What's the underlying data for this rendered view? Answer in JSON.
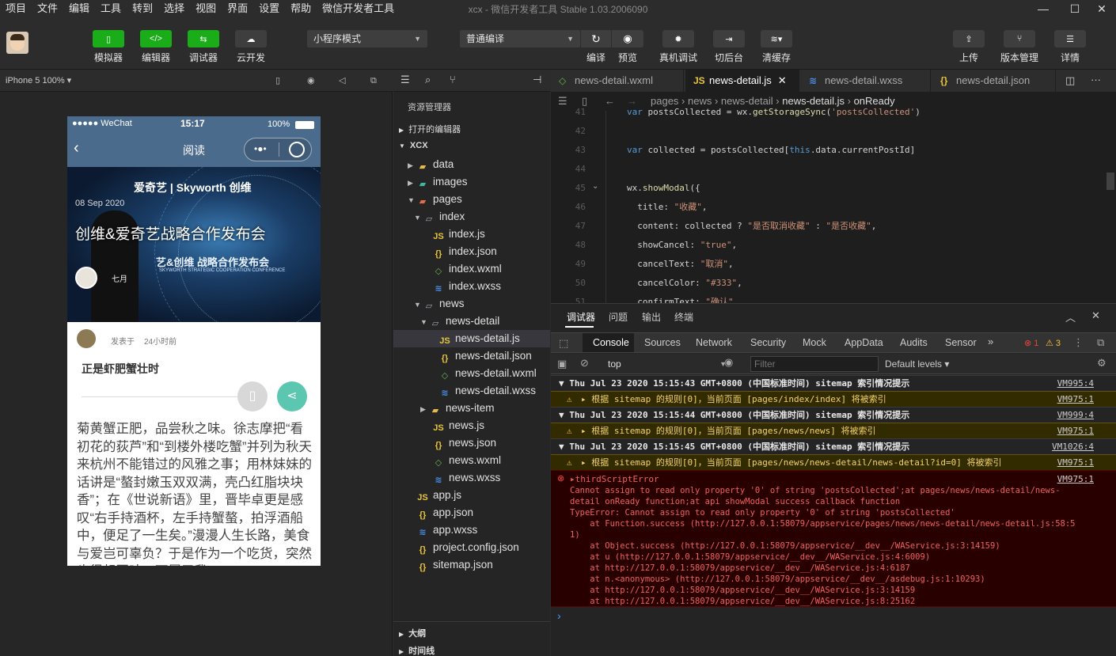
{
  "menubar": {
    "items": [
      "项目",
      "文件",
      "编辑",
      "工具",
      "转到",
      "选择",
      "视图",
      "界面",
      "设置",
      "帮助",
      "微信开发者工具"
    ],
    "title": "xcx - 微信开发者工具 Stable 1.03.2006090"
  },
  "toolbar": {
    "left_buttons": [
      {
        "label": "模拟器",
        "icon": "phone-icon"
      },
      {
        "label": "编辑器",
        "icon": "code-icon"
      },
      {
        "label": "调试器",
        "icon": "debug-icon"
      },
      {
        "label": "云开发",
        "icon": "cloud-icon"
      }
    ],
    "mode_select": "小程序模式",
    "compile_select": "普通编译",
    "compile_label": "编译",
    "preview_label": "预览",
    "real_debug_label": "真机调试",
    "background_label": "切后台",
    "clear_cache_label": "清缓存",
    "upload_label": "上传",
    "version_label": "版本管理",
    "details_label": "详情"
  },
  "simulator": {
    "device": "iPhone 5 100% ▾",
    "status_carrier": "●●●●● WeChat",
    "status_time": "15:17",
    "status_battery": "100%",
    "nav_title": "阅读",
    "hero_date": "08 Sep 2020",
    "hero_title": "创维&爱奇艺战略合作发布会",
    "hero_brand": "爱奇艺 | Skyworth 创维",
    "hero_sub": "艺&创维 战略合作发布会",
    "hero_sub_en": "SKYWORTH STRATEGIC COOPERATION CONFERENCE",
    "hero_author": "七月",
    "post_meta": "发表于",
    "post_time": "24小时前",
    "post_title": "正是虾肥蟹壮时",
    "article": "菊黄蟹正肥，品尝秋之味。徐志摩把“看初花的荻芦”和“到楼外楼吃蟹”并列为秋天来杭州不能错过的风雅之事；用林妹妹的话讲是“螯封嫩玉双双满，壳凸红脂块块香”；在《世说新语》里，晋毕卓更是感叹“右手持酒杯，左手持蟹螯，拍浮酒船中，便足了一生矣。”漫漫人生长路，美食与爱岂可辜负？于是作为一个吃货，突然也很想回味一下属于我"
  },
  "explorer": {
    "header": "资源管理器",
    "open_editors": "打开的编辑器",
    "project": "XCX",
    "tree": [
      {
        "label": "data",
        "depth": 1,
        "type": "folder",
        "arrow": "▸"
      },
      {
        "label": "images",
        "depth": 1,
        "type": "folder-img",
        "arrow": "▸"
      },
      {
        "label": "pages",
        "depth": 1,
        "type": "folder-pages",
        "arrow": "▾"
      },
      {
        "label": "index",
        "depth": 2,
        "type": "folder-open",
        "arrow": "▾"
      },
      {
        "label": "index.js",
        "depth": 3,
        "type": "js",
        "arrow": ""
      },
      {
        "label": "index.json",
        "depth": 3,
        "type": "json",
        "arrow": ""
      },
      {
        "label": "index.wxml",
        "depth": 3,
        "type": "wxml",
        "arrow": ""
      },
      {
        "label": "index.wxss",
        "depth": 3,
        "type": "wxss",
        "arrow": ""
      },
      {
        "label": "news",
        "depth": 2,
        "type": "folder-open",
        "arrow": "▾"
      },
      {
        "label": "news-detail",
        "depth": 3,
        "type": "folder-open",
        "arrow": "▾"
      },
      {
        "label": "news-detail.js",
        "depth": 4,
        "type": "js",
        "arrow": "",
        "selected": true
      },
      {
        "label": "news-detail.json",
        "depth": 4,
        "type": "json",
        "arrow": ""
      },
      {
        "label": "news-detail.wxml",
        "depth": 4,
        "type": "wxml",
        "arrow": ""
      },
      {
        "label": "news-detail.wxss",
        "depth": 4,
        "type": "wxss",
        "arrow": ""
      },
      {
        "label": "news-item",
        "depth": 3,
        "type": "folder",
        "arrow": "▸"
      },
      {
        "label": "news.js",
        "depth": 3,
        "type": "js",
        "arrow": ""
      },
      {
        "label": "news.json",
        "depth": 3,
        "type": "json",
        "arrow": ""
      },
      {
        "label": "news.wxml",
        "depth": 3,
        "type": "wxml",
        "arrow": ""
      },
      {
        "label": "news.wxss",
        "depth": 3,
        "type": "wxss",
        "arrow": ""
      },
      {
        "label": "app.js",
        "depth": 1,
        "type": "js",
        "arrow": ""
      },
      {
        "label": "app.json",
        "depth": 1,
        "type": "json",
        "arrow": ""
      },
      {
        "label": "app.wxss",
        "depth": 1,
        "type": "wxss",
        "arrow": ""
      },
      {
        "label": "project.config.json",
        "depth": 1,
        "type": "json",
        "arrow": ""
      },
      {
        "label": "sitemap.json",
        "depth": 1,
        "type": "json",
        "arrow": ""
      }
    ],
    "outline": "大纲",
    "timeline": "时间线"
  },
  "editor": {
    "tabs": [
      {
        "label": "news-detail.wxml",
        "icon": "wxml",
        "active": false
      },
      {
        "label": "news-detail.js",
        "icon": "js",
        "active": true
      },
      {
        "label": "news-detail.wxss",
        "icon": "wxss",
        "active": false
      },
      {
        "label": "news-detail.json",
        "icon": "json",
        "active": false
      }
    ],
    "breadcrumb": [
      "pages",
      "news",
      "news-detail",
      "news-detail.js",
      "onReady"
    ],
    "lines": [
      {
        "n": "41",
        "html": "<span style=\"color:#569cd6\">var</span> postsCollected = wx.<span style=\"color:#dcdcaa\">getStorageSync</span>(<span style=\"color:#ce9178\">'postsCollected'</span>)"
      },
      {
        "n": "42",
        "html": ""
      },
      {
        "n": "43",
        "html": "<span style=\"color:#569cd6\">var</span> collected = postsCollected[<span style=\"color:#569cd6\">this</span>.data.currentPostId]"
      },
      {
        "n": "44",
        "html": ""
      },
      {
        "n": "45",
        "html": "wx.<span style=\"color:#dcdcaa\">showModal</span>({"
      },
      {
        "n": "46",
        "html": "  title: <span style=\"color:#ce9178\">\"收藏\"</span>,"
      },
      {
        "n": "47",
        "html": "  content: collected ? <span style=\"color:#ce9178\">\"是否取消收藏\"</span> : <span style=\"color:#ce9178\">\"是否收藏\"</span>,"
      },
      {
        "n": "48",
        "html": "  showCancel: <span style=\"color:#ce9178\">\"true\"</span>,"
      },
      {
        "n": "49",
        "html": "  cancelText: <span style=\"color:#ce9178\">\"取消\"</span>,"
      },
      {
        "n": "50",
        "html": "  cancelColor: <span style=\"color:#ce9178\">\"#333\"</span>,"
      },
      {
        "n": "51",
        "html": "  confirmText: <span style=\"color:#ce9178\">\"确认\"</span>,"
      }
    ]
  },
  "devtools": {
    "top_tabs": [
      "调试器",
      "问题",
      "输出",
      "终端"
    ],
    "console_tabs": [
      "Console",
      "Sources",
      "Network",
      "Security",
      "Mock",
      "AppData",
      "Audits",
      "Sensor"
    ],
    "error_count": "1",
    "warn_count": "3",
    "context": "top",
    "filter_placeholder": "Filter",
    "levels": "Default levels ▾",
    "logs": [
      {
        "kind": "group",
        "text": "▼ Thu Jul 23 2020 15:15:43 GMT+0800 (中国标准时间) sitemap 索引情况提示",
        "src": "VM995:4"
      },
      {
        "kind": "warn",
        "text": "▸ 根据 sitemap 的规则[0]，当前页面 [pages/index/index] 将被索引",
        "src": "VM975:1"
      },
      {
        "kind": "group",
        "text": "▼ Thu Jul 23 2020 15:15:44 GMT+0800 (中国标准时间) sitemap 索引情况提示",
        "src": "VM999:4"
      },
      {
        "kind": "warn",
        "text": "▸ 根据 sitemap 的规则[0]，当前页面 [pages/news/news] 将被索引",
        "src": "VM975:1"
      },
      {
        "kind": "group",
        "text": "▼ Thu Jul 23 2020 15:15:45 GMT+0800 (中国标准时间) sitemap 索引情况提示",
        "src": "VM1026:4"
      },
      {
        "kind": "warn",
        "text": "▸ 根据 sitemap 的规则[0]，当前页面 [pages/news/news-detail/news-detail?id=0] 将被索引",
        "src": "VM975:1"
      }
    ],
    "error": {
      "head": "▸thirdScriptError",
      "src": "VM975:1",
      "lines": [
        "Cannot assign to read only property '0' of string 'postsCollected';at pages/news/news-detail/news-",
        "detail onReady function;at api showModal success callback function",
        "TypeError: Cannot assign to read only property '0' of string 'postsCollected'",
        "    at Function.success (http://127.0.0.1:58079/appservice/pages/news/news-detail/news-detail.js:58:5",
        "1)",
        "    at Object.success (http://127.0.0.1:58079/appservice/__dev__/WAService.js:3:14159)",
        "    at u (http://127.0.0.1:58079/appservice/__dev__/WAService.js:4:6009)",
        "    at http://127.0.0.1:58079/appservice/__dev__/WAService.js:4:6187",
        "    at n.<anonymous> (http://127.0.0.1:58079/appservice/__dev__/asdebug.js:1:10293)",
        "    at http://127.0.0.1:58079/appservice/__dev__/WAService.js:3:14159",
        "    at http://127.0.0.1:58079/appservice/__dev__/WAService.js:8:25162"
      ]
    },
    "prompt": "›"
  },
  "colors": {
    "accent_green": "#1aad19",
    "nav_blue": "#4b6b8c",
    "error_bg": "#290000",
    "warn_bg": "#332b00"
  }
}
